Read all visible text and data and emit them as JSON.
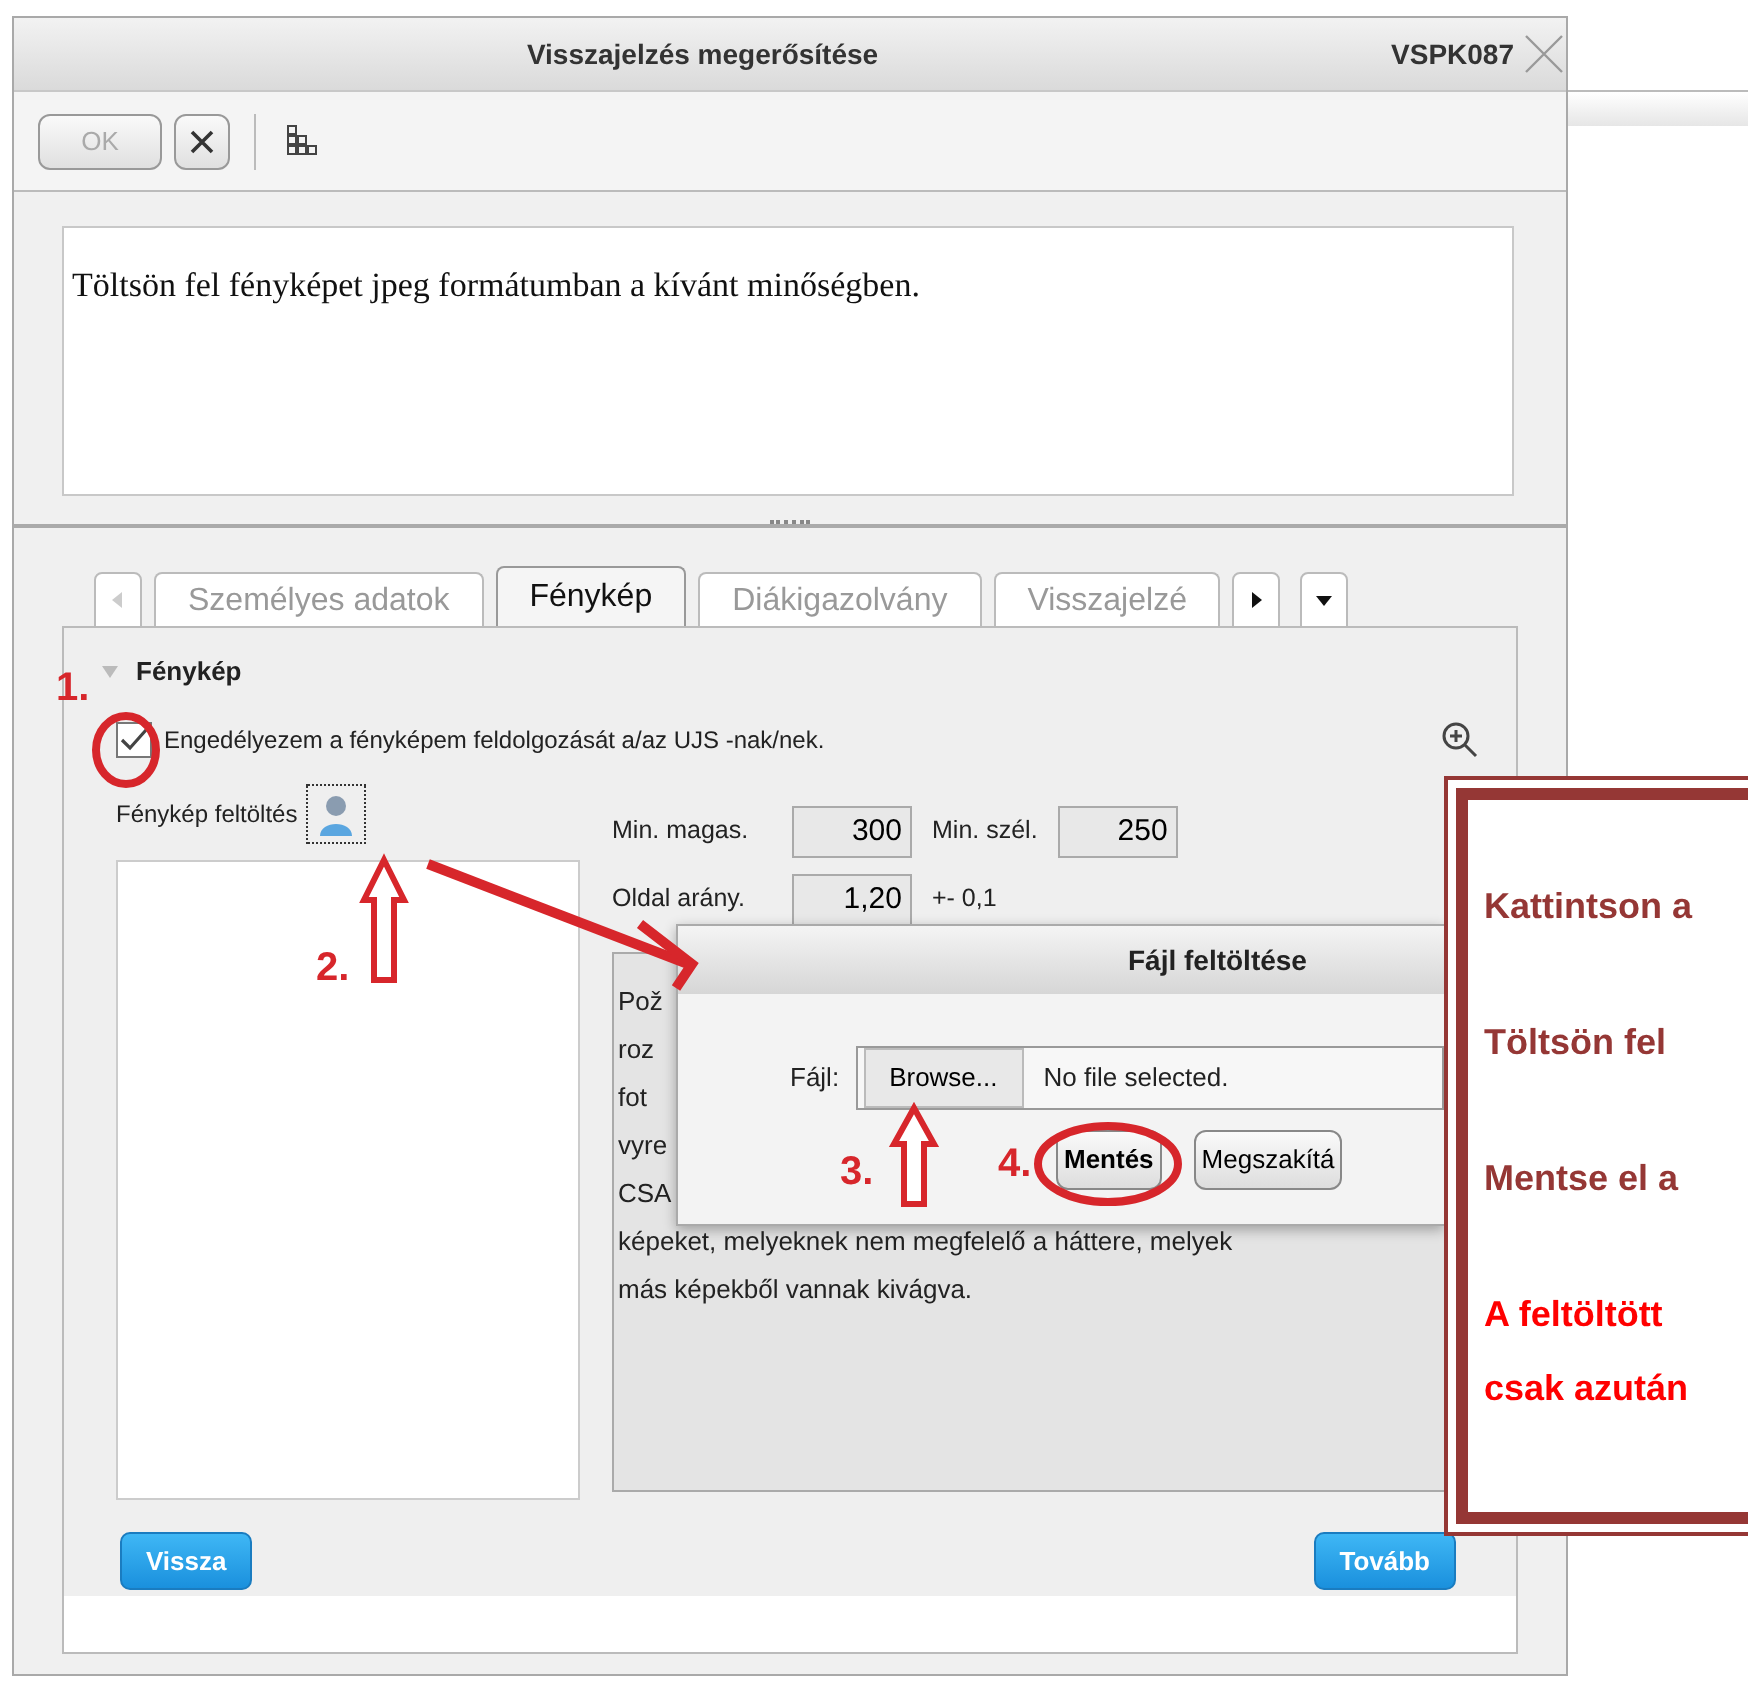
{
  "window": {
    "title": "Visszajelzés megerősítése",
    "code": "VSPK087"
  },
  "toolbar": [
    {
      "kind": "text",
      "label": "OK",
      "disabled": true
    },
    {
      "kind": "close",
      "disabled": false
    },
    {
      "kind": "grid",
      "disabled": false
    }
  ],
  "instruction": "Töltsön fel fényképet jpeg formátumban a kívánt minőségben.",
  "tabs": [
    {
      "label": "Személyes adatok",
      "selected": false
    },
    {
      "label": "Fénykép",
      "selected": true
    },
    {
      "label": "Diákigazolvány",
      "selected": false
    },
    {
      "label": "Visszajelzé",
      "selected": false
    }
  ],
  "section": {
    "title": "Fénykép",
    "expanded": true
  },
  "consent": {
    "label": "Engedélyezem a fényképem feldolgozását a/az UJS -nak/nek.",
    "checked": true
  },
  "upload_label": "Fénykép feltöltés",
  "fields": [
    {
      "label": "Min. magas.",
      "value": "300"
    },
    {
      "label": "Min. szél.",
      "value": "250"
    },
    {
      "label": "Oldal arány.",
      "value": "1,20",
      "suffix": "+- 0,1"
    }
  ],
  "notes": [
    "Pož",
    "roz",
    "fot",
    "vyre",
    "CSA",
    "képeket, melyeknek nem megfelelő a háttere, melyek",
    "más képekből vannak kivágva."
  ],
  "buttons": [
    {
      "label": "Vissza"
    },
    {
      "label": "Tovább"
    }
  ],
  "file_dialog": {
    "title": "Fájl feltöltése",
    "field_label": "Fájl:",
    "browse": "Browse...",
    "file_status": "No file selected.",
    "buttons": [
      "Mentés",
      "Megszakítá"
    ]
  },
  "callout": [
    {
      "text": "Kattintson a",
      "color": "#953735"
    },
    {
      "text": "Töltsön fel",
      "color": "#953735"
    },
    {
      "text": "Mentse el a",
      "color": "#953735"
    },
    {
      "text": "A feltöltött",
      "color": "#ff0000"
    },
    {
      "text": "csak azután",
      "color": "#ff0000"
    }
  ],
  "annotations": [
    {
      "label": "1."
    },
    {
      "label": "2."
    },
    {
      "label": "3."
    },
    {
      "label": "4."
    }
  ]
}
